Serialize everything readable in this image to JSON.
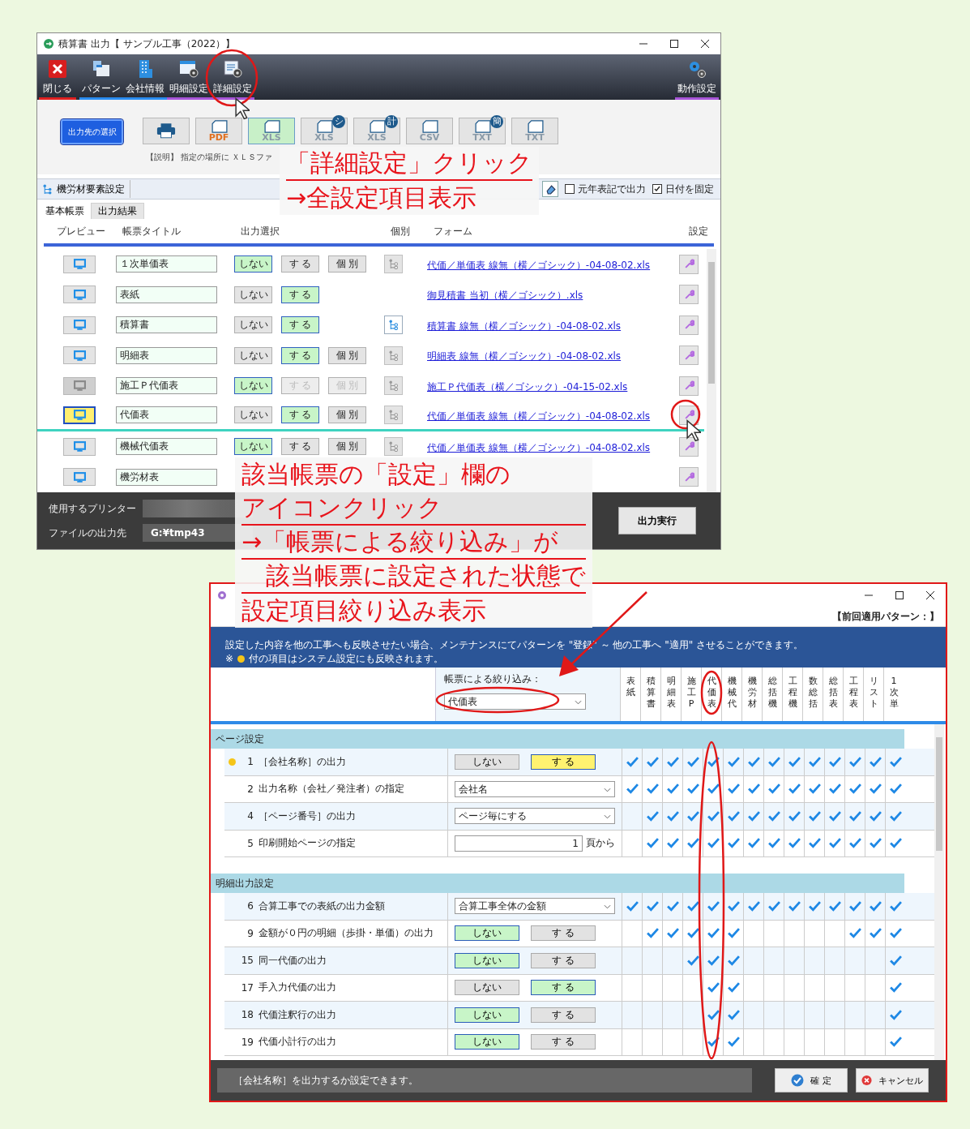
{
  "top_window": {
    "title": "積算書 出力【 サンプル工事（2022）】",
    "toolbar": [
      {
        "label": "閉じる",
        "color": "#e02020"
      },
      {
        "label": "パターン",
        "color": "#2a8cf0"
      },
      {
        "label": "会社情報",
        "color": "#2a8cf0"
      },
      {
        "label": "明細設定",
        "color": "#a855d8"
      },
      {
        "label": "詳細設定",
        "color": "#a855d8"
      }
    ],
    "toolbar_right": {
      "label": "動作設定",
      "color": "#a855d8"
    },
    "output_target_button": "出力先の選択",
    "formats": [
      {
        "kind": "printer",
        "selected": false
      },
      {
        "kind": "file",
        "label": "PDF",
        "selected": false
      },
      {
        "kind": "file",
        "label": "XLS",
        "selected": true
      },
      {
        "kind": "file",
        "label": "XLS",
        "badge": "シ",
        "selected": false
      },
      {
        "kind": "file",
        "label": "XLS",
        "badge": "計",
        "selected": false
      },
      {
        "kind": "file",
        "label": "CSV",
        "selected": false
      },
      {
        "kind": "file",
        "label": "TXT",
        "badge": "簡",
        "selected": false
      },
      {
        "kind": "file",
        "label": "TXT",
        "selected": false
      }
    ],
    "description": "【説明】 指定の場所に ＸＬＳファ",
    "element_settings_button": "機労材要素設定",
    "options": [
      {
        "label": "元年表記で出力",
        "checked": false
      },
      {
        "label": "日付を固定",
        "checked": true
      }
    ],
    "tabs": [
      {
        "label": "基本帳票",
        "selected": true
      },
      {
        "label": "出力結果",
        "selected": false
      }
    ],
    "columns": [
      "プレビュー",
      "帳票タイトル",
      "出力選択",
      "個別",
      "フォーム",
      "設定"
    ],
    "rows": [
      {
        "preview_highlighted": false,
        "preview_disabled": false,
        "title": "１次単価表",
        "choices": [
          {
            "label": "しない",
            "selected": true,
            "disabled": false
          },
          {
            "label": "す る",
            "selected": false,
            "disabled": false
          },
          {
            "label": "個 別",
            "selected": false,
            "disabled": false
          }
        ],
        "branch_enabled": false,
        "form": "代価／単価表 線無（横／ゴシック）-04-08-02.xls",
        "current": false
      },
      {
        "preview_highlighted": false,
        "preview_disabled": false,
        "title": "表紙",
        "choices": [
          {
            "label": "しない",
            "selected": false,
            "disabled": false
          },
          {
            "label": "す る",
            "selected": true,
            "disabled": false
          }
        ],
        "form": "御見積書 当初（横／ゴシック）.xls",
        "current": false
      },
      {
        "preview_highlighted": false,
        "preview_disabled": false,
        "title": "積算書",
        "choices": [
          {
            "label": "しない",
            "selected": false,
            "disabled": false
          },
          {
            "label": "す る",
            "selected": true,
            "disabled": false
          }
        ],
        "branch_enabled": true,
        "form": "積算書 線無（横／ゴシック）-04-08-02.xls",
        "current": false
      },
      {
        "preview_highlighted": false,
        "preview_disabled": false,
        "title": "明細表",
        "choices": [
          {
            "label": "しない",
            "selected": false,
            "disabled": false
          },
          {
            "label": "す る",
            "selected": true,
            "disabled": false
          },
          {
            "label": "個 別",
            "selected": false,
            "disabled": false
          }
        ],
        "branch_enabled": false,
        "form": "明細表 線無（横／ゴシック）-04-08-02.xls",
        "current": false
      },
      {
        "preview_highlighted": false,
        "preview_disabled": true,
        "title": "施工Ｐ代価表",
        "choices": [
          {
            "label": "しない",
            "selected": true,
            "disabled": false
          },
          {
            "label": "す る",
            "selected": false,
            "disabled": true
          },
          {
            "label": "個 別",
            "selected": false,
            "disabled": true
          }
        ],
        "branch_enabled": false,
        "form": "施工Ｐ代価表（横／ゴシック）-04-15-02.xls",
        "current": false
      },
      {
        "preview_highlighted": true,
        "preview_disabled": false,
        "title": "代価表",
        "choices": [
          {
            "label": "しない",
            "selected": false,
            "disabled": false
          },
          {
            "label": "す る",
            "selected": true,
            "disabled": false
          },
          {
            "label": "個 別",
            "selected": false,
            "disabled": false
          }
        ],
        "branch_enabled": false,
        "form": "代価／単価表 線無（横／ゴシック）-04-08-02.xls",
        "current": true
      },
      {
        "preview_highlighted": false,
        "preview_disabled": false,
        "title": "機械代価表",
        "choices": [
          {
            "label": "しない",
            "selected": true,
            "disabled": false
          },
          {
            "label": "す る",
            "selected": false,
            "disabled": false
          },
          {
            "label": "個 別",
            "selected": false,
            "disabled": false
          }
        ],
        "branch_enabled": false,
        "form": "代価／単価表 線無（横／ゴシック）-04-08-02.xls",
        "current": false
      },
      {
        "preview_highlighted": false,
        "preview_disabled": false,
        "title": "機労材表",
        "choices": [],
        "current": false
      }
    ],
    "printer_label": "使用するプリンター",
    "output_path_label": "ファイルの出力先",
    "output_path": "G:¥tmp43",
    "run_button": "出力実行"
  },
  "detail_window": {
    "pattern_label": "【前回適用パターン：】",
    "notice": "設定した内容を他の工事へも反映させたい場合、メンテナンスにてパターンを \"登録\" ～ 他の工事へ \"適用\" させることができます。",
    "note": {
      "prefix": "※",
      "text": "付の項目はシステム設定にも反映されます。"
    },
    "filter": {
      "label": "帳票による絞り込み：",
      "value": "代価表"
    },
    "report_columns": [
      "表紙",
      "積算書",
      "明細表",
      "施工P",
      "代価表",
      "機械代",
      "機労材",
      "総括機",
      "工程機",
      "数総括",
      "総括表",
      "工程表",
      "リスト",
      "1次単"
    ],
    "sections": [
      {
        "title": "ページ設定",
        "rows": [
          {
            "number": "1",
            "label": "［会社名称］の出力",
            "system": true,
            "control": {
              "kind": "toggle",
              "current": true,
              "choices": [
                {
                  "label": "しない",
                  "selected": false
                },
                {
                  "label": "す る",
                  "selected": true
                }
              ]
            },
            "applies": [
              true,
              true,
              true,
              true,
              true,
              true,
              true,
              true,
              true,
              true,
              true,
              true,
              true,
              true
            ]
          },
          {
            "number": "2",
            "label": "出力名称（会社／発注者）の指定",
            "system": false,
            "control": {
              "kind": "select",
              "value": "会社名"
            },
            "applies": [
              true,
              true,
              true,
              true,
              true,
              true,
              true,
              true,
              true,
              true,
              true,
              true,
              true,
              true
            ]
          },
          {
            "number": "4",
            "label": "［ページ番号］の出力",
            "system": false,
            "control": {
              "kind": "select",
              "value": "ページ毎にする"
            },
            "applies": [
              false,
              true,
              true,
              true,
              true,
              true,
              true,
              true,
              true,
              true,
              true,
              true,
              true,
              true
            ]
          },
          {
            "number": "5",
            "label": "印刷開始ページの指定",
            "system": false,
            "control": {
              "kind": "number",
              "value": "1",
              "suffix": "頁から"
            },
            "applies": [
              false,
              true,
              true,
              true,
              true,
              true,
              true,
              true,
              true,
              true,
              true,
              true,
              true,
              true
            ]
          }
        ]
      },
      {
        "title": "明細出力設定",
        "rows": [
          {
            "number": "6",
            "label": "合算工事での表紙の出力金額",
            "system": false,
            "control": {
              "kind": "select",
              "value": "合算工事全体の金額"
            },
            "applies": [
              true,
              true,
              true,
              true,
              true,
              true,
              true,
              true,
              true,
              true,
              true,
              true,
              true,
              true
            ]
          },
          {
            "number": "9",
            "label": "金額が０円の明細（歩掛・単価）の出力",
            "system": false,
            "control": {
              "kind": "toggle",
              "current": false,
              "choices": [
                {
                  "label": "しない",
                  "selected": true
                },
                {
                  "label": "す る",
                  "selected": false
                }
              ]
            },
            "applies": [
              false,
              true,
              true,
              true,
              true,
              true,
              false,
              false,
              false,
              false,
              false,
              true,
              true,
              true
            ]
          },
          {
            "number": "15",
            "label": "同一代価の出力",
            "system": false,
            "control": {
              "kind": "toggle",
              "current": false,
              "choices": [
                {
                  "label": "しない",
                  "selected": true
                },
                {
                  "label": "す る",
                  "selected": false
                }
              ]
            },
            "applies": [
              false,
              false,
              false,
              true,
              true,
              true,
              false,
              false,
              false,
              false,
              false,
              false,
              false,
              true
            ]
          },
          {
            "number": "17",
            "label": "手入力代価の出力",
            "system": false,
            "control": {
              "kind": "toggle",
              "current": false,
              "choices": [
                {
                  "label": "しない",
                  "selected": false
                },
                {
                  "label": "す る",
                  "selected": true
                }
              ]
            },
            "applies": [
              false,
              false,
              false,
              false,
              true,
              true,
              false,
              false,
              false,
              false,
              false,
              false,
              false,
              true
            ]
          },
          {
            "number": "18",
            "label": "代価注釈行の出力",
            "system": false,
            "control": {
              "kind": "toggle",
              "current": false,
              "choices": [
                {
                  "label": "しない",
                  "selected": true
                },
                {
                  "label": "す る",
                  "selected": false
                }
              ]
            },
            "applies": [
              false,
              false,
              false,
              false,
              true,
              true,
              false,
              false,
              false,
              false,
              false,
              false,
              false,
              true
            ]
          },
          {
            "number": "19",
            "label": "代価小計行の出力",
            "system": false,
            "control": {
              "kind": "toggle",
              "current": false,
              "choices": [
                {
                  "label": "しない",
                  "selected": true
                },
                {
                  "label": "す る",
                  "selected": false
                }
              ]
            },
            "applies": [
              false,
              false,
              false,
              false,
              true,
              true,
              false,
              false,
              false,
              false,
              false,
              false,
              false,
              true
            ]
          }
        ]
      }
    ],
    "status": "［会社名称］を出力するか設定できます。",
    "buttons": [
      {
        "label": "確 定"
      },
      {
        "label": "キャンセル"
      }
    ]
  },
  "callouts": [
    {
      "lines": [
        "「詳細設定」クリック",
        "→全設定項目表示"
      ]
    },
    {
      "lines": [
        "該当帳票の「設定」欄の",
        "アイコンクリック",
        "→「帳票による絞り込み」が",
        "　該当帳票に設定された状態で",
        "設定項目絞り込み表示"
      ]
    }
  ]
}
